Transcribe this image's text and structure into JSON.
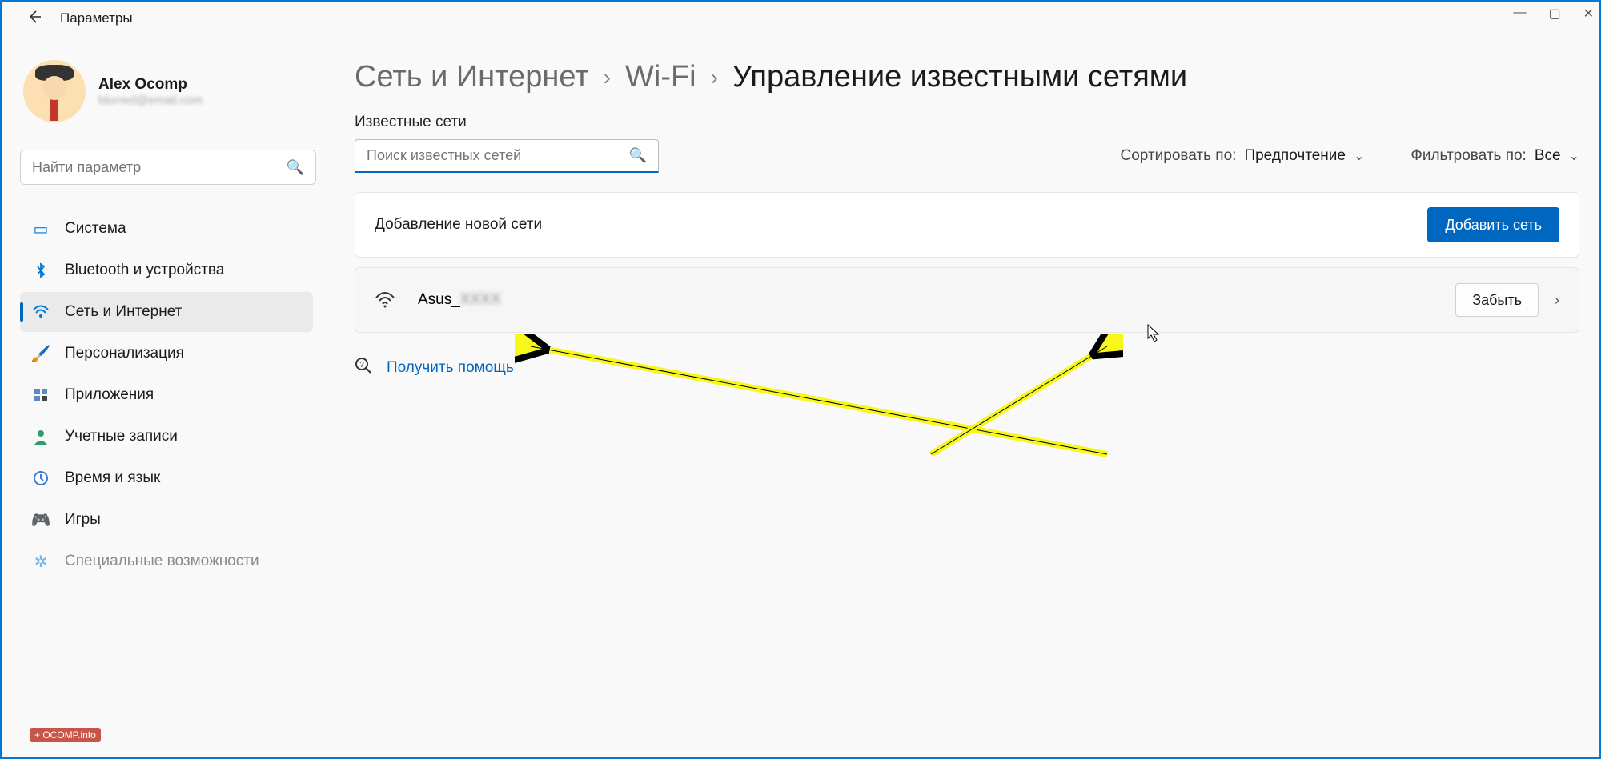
{
  "window": {
    "title": "Параметры",
    "controls": {
      "min": "—",
      "max": "▢",
      "close": "✕"
    }
  },
  "user": {
    "name": "Alex Ocomp",
    "sub": "blurred@email.com"
  },
  "sidebar": {
    "search_placeholder": "Найти параметр",
    "items": [
      {
        "label": "Система",
        "icon": "🖥️"
      },
      {
        "label": "Bluetooth и устройства",
        "icon": "ᚼ"
      },
      {
        "label": "Сеть и Интернет",
        "icon": "📶",
        "selected": true
      },
      {
        "label": "Персонализация",
        "icon": "🖌️"
      },
      {
        "label": "Приложения",
        "icon": "▦"
      },
      {
        "label": "Учетные записи",
        "icon": "👤"
      },
      {
        "label": "Время и язык",
        "icon": "🕒"
      },
      {
        "label": "Игры",
        "icon": "🎮"
      },
      {
        "label": "Специальные возможности",
        "icon": "♿"
      }
    ]
  },
  "breadcrumb": {
    "parts": [
      "Сеть и Интернет",
      "Wi-Fi"
    ],
    "current": "Управление известными сетями",
    "sep": "›"
  },
  "known": {
    "section_label": "Известные сети",
    "search_placeholder": "Поиск известных сетей",
    "sort_label": "Сортировать по:",
    "sort_value": "Предпочтение",
    "filter_label": "Фильтровать по:",
    "filter_value": "Все",
    "add_label": "Добавление новой сети",
    "add_button": "Добавить сеть",
    "networks": [
      {
        "name_visible": "Asus_",
        "name_hidden": "XXXX",
        "forget": "Забыть"
      }
    ]
  },
  "help": {
    "label": "Получить помощь"
  }
}
